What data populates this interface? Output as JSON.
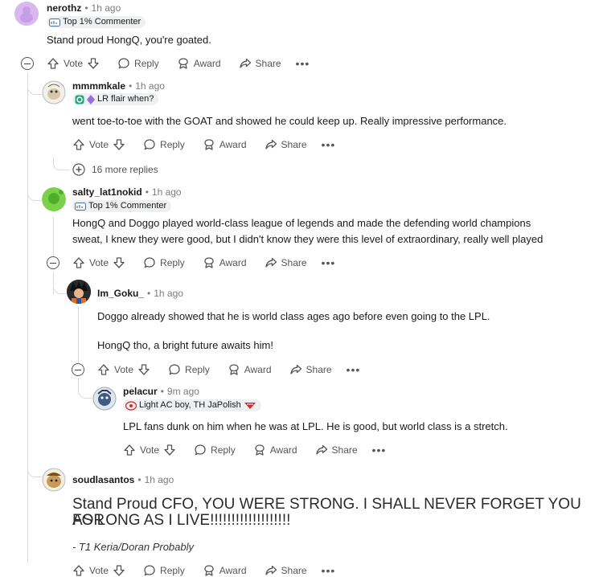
{
  "actions": {
    "vote": "Vote",
    "reply": "Reply",
    "award": "Award",
    "share": "Share",
    "more": "•••"
  },
  "comments": [
    {
      "user": "nerothz",
      "time": "1h ago",
      "flair": "Top 1% Commenter",
      "body": "Stand proud HongQ, you're goated."
    },
    {
      "user": "mmmmkale",
      "time": "1h ago",
      "flair": "LR flair when?",
      "body": "went toe-to-toe with the GOAT and showed he could keep up. Really impressive performance."
    },
    {
      "user": "salty_lat1nokid",
      "time": "1h ago",
      "flair": "Top 1% Commenter",
      "body_lines": [
        "HongQ and Doggo played world-class league of legends and made the defending world champions",
        "sweat, I knew they were good, but I didn't know they were this level of extraordinary, really well played"
      ]
    },
    {
      "user": "Im_Goku_",
      "time": "1h ago",
      "body_paragraphs": [
        "Doggo already showed that he is world class ages ago before even going to the LPL.",
        "HongQ tho, a bright future awaits him!"
      ]
    },
    {
      "user": "pelacur",
      "time": "9m ago",
      "flair": "Light AC boy, TH JaPolish",
      "body": "LPL fans dunk on him when he was at LPL. He is good, but world class is a stretch."
    },
    {
      "user": "soudlasantos",
      "time": "1h ago",
      "body_large_lines": [
        "Stand Proud CFO, YOU WERE STRONG. I SHALL NEVER FORGET YOU FOR",
        "AS LONG AS I LIVE!!!!!!!!!!!!!!!!!!!"
      ],
      "body_italic": "- T1 Keria/Doran Probably"
    }
  ],
  "more_replies": "16 more replies",
  "colors": {
    "meta_gray": "#7c7c7c",
    "thread_line": "#d8dadc",
    "flair_bg": "#eef0f2"
  }
}
